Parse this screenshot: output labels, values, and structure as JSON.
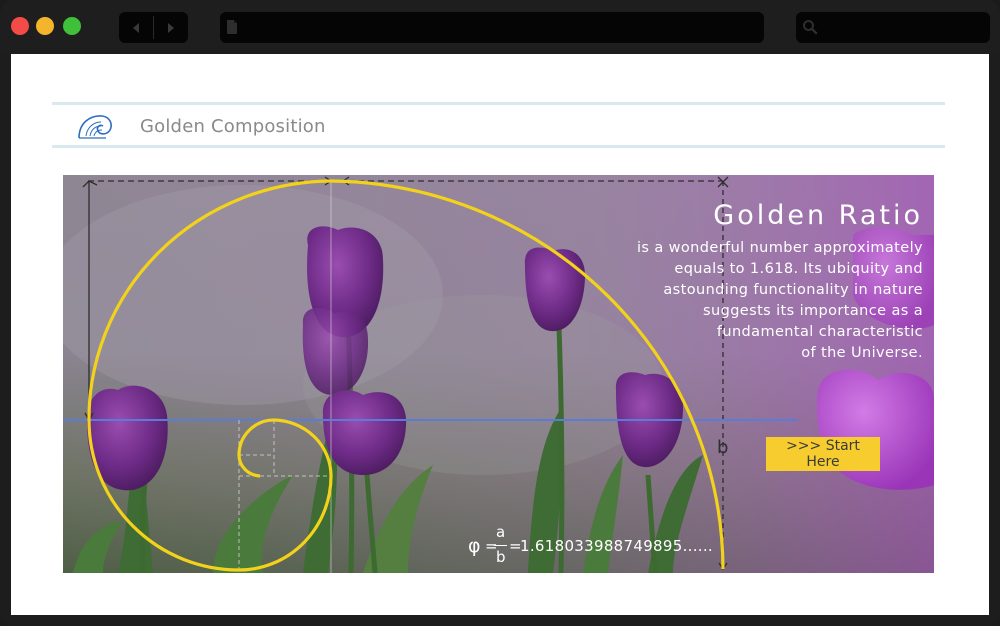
{
  "browser": {
    "window_controls": [
      "close",
      "minimize",
      "maximize"
    ],
    "nav": {
      "back_icon": "back-arrow-icon",
      "forward_icon": "forward-arrow-icon"
    },
    "address_bar": {
      "value": "",
      "icon": "page-icon"
    },
    "search_bar": {
      "value": "",
      "icon": "search-icon"
    }
  },
  "site": {
    "logo_icon": "nautilus-spiral-icon",
    "title": "Golden Composition"
  },
  "hero": {
    "heading": "Golden Ratio",
    "description_lines": [
      "is a wonderful number approximately",
      "equals to 1.618. Its ubiquity and",
      "astounding functionality in nature",
      "suggests its importance as a",
      "fundamental characteristic",
      "of the Universe."
    ],
    "cta_label": ">>> Start Here",
    "formula": {
      "phi": "φ",
      "equals": "=",
      "numerator": "a",
      "denominator": "b",
      "value": "1.618033988749895......"
    },
    "side_label": "b",
    "colors": {
      "spiral": "#f2d21a",
      "cta": "#f6cc2e",
      "horizon_line": "#5a7cd6",
      "guide": "#3a3a3a"
    }
  }
}
